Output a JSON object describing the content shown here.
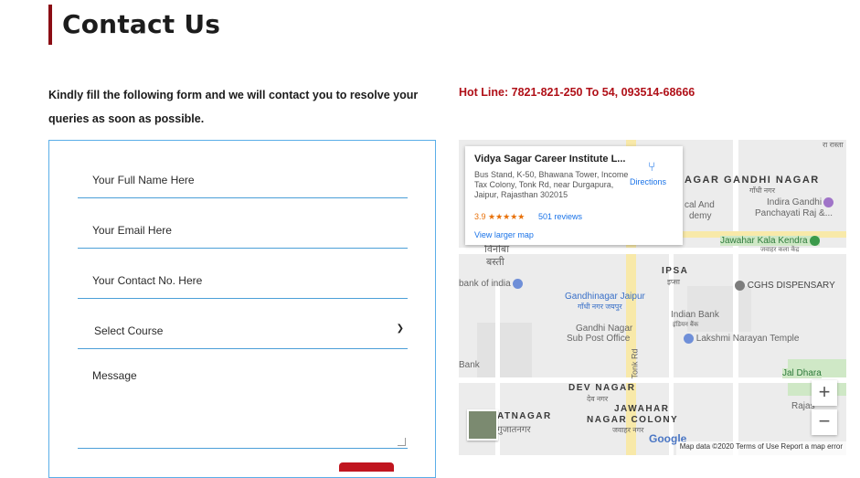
{
  "heading": "Contact Us",
  "intro": "Kindly fill the following form and we will contact you to resolve your queries as soon as possible.",
  "hotline": "Hot Line: 7821-821-250 To 54, 093514-68666",
  "form": {
    "name_placeholder": "Your Full Name Here",
    "email_placeholder": "Your Email Here",
    "contact_placeholder": "Your Contact No. Here",
    "course_selected": "Select Course",
    "message_placeholder": "Message"
  },
  "map": {
    "card": {
      "name": "Vidya Sagar Career Institute L...",
      "address": "Bus Stand, K-50, Bhawana Tower, Income Tax Colony, Tonk Rd, near Durgapura, Jaipur, Rajasthan 302015",
      "rating": "3.9 ★★★★★",
      "reviews": "501 reviews",
      "directions": "Directions",
      "view_larger": "View larger map"
    },
    "labels": {
      "gandhi_nagar": "GANDHI NAGAR",
      "gandhi_nagar_hi": "गाँधी नगर",
      "indira_gandhi": "Indira Gandhi",
      "panchayati": "Panchayati Raj &...",
      "cal_and": "cal And",
      "demy": "demy",
      "jawahar_kala": "Jawahar Kala Kendra",
      "jawahar_kala_hi": "जवाहर कला केंद्र",
      "vinoba": "विनोबा",
      "basti": "बस्ती",
      "bank_india": "bank of india",
      "ipsa": "IPSA",
      "ipsa_hi": "इप्सा",
      "cghs": "CGHS DISPENSARY",
      "gandhinagar_jaipur": "Gandhinagar Jaipur",
      "gandhinagar_jaipur_hi": "गाँधी नगर जयपुर",
      "indian_bank": "Indian Bank",
      "indian_bank_hi": "इंडियन बैंक",
      "gandhi_po": "Gandhi Nagar",
      "sub_po": "Sub Post Office",
      "lakshmi": "Lakshmi Narayan Temple",
      "tonk_rd": "Tonk Rd",
      "bank": "Bank",
      "jal_dhara": "Jal Dhara",
      "dev_nagar": "DEV NAGAR",
      "dev_nagar_hi": "देव नगर",
      "jawahar": "JAWAHAR",
      "nagar_colony": "NAGAR COLONY",
      "jawahar_hi": "जवाहर नगर",
      "atnagar": "ATNAGAR",
      "gujatnagar_hi": "गुजातनगर",
      "rajas": "Rajas",
      "raj_top": "रा रास्ता",
      "brand": "Google"
    },
    "footer": "Map data ©2020   Terms of Use   Report a map error",
    "zoom_in": "+",
    "zoom_out": "−"
  }
}
